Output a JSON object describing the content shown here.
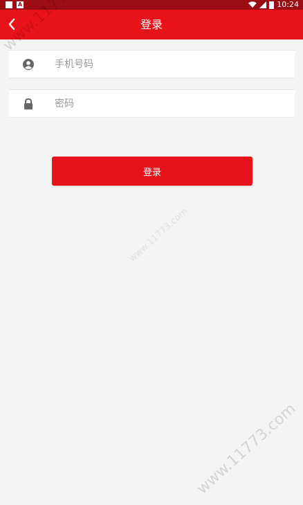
{
  "status_bar": {
    "left_icons": [
      "notification-square-icon",
      "a-badge-icon"
    ],
    "right_icons": [
      "wifi-icon",
      "signal-icon",
      "battery-icon"
    ],
    "time": "10:24"
  },
  "app_bar": {
    "title": "登录",
    "back_icon": "chevron-left-icon",
    "background": "#e8121a"
  },
  "form": {
    "phone": {
      "icon": "user-circle-icon",
      "placeholder": "手机号码",
      "value": ""
    },
    "password": {
      "icon": "lock-icon",
      "placeholder": "密码",
      "value": ""
    },
    "submit_label": "登录"
  },
  "watermark": {
    "text": "www.11773.com"
  },
  "colors": {
    "status_bar": "#9b0d12",
    "accent": "#e8121a",
    "page_background": "#f4f4f4",
    "placeholder": "#9a9a9a"
  }
}
